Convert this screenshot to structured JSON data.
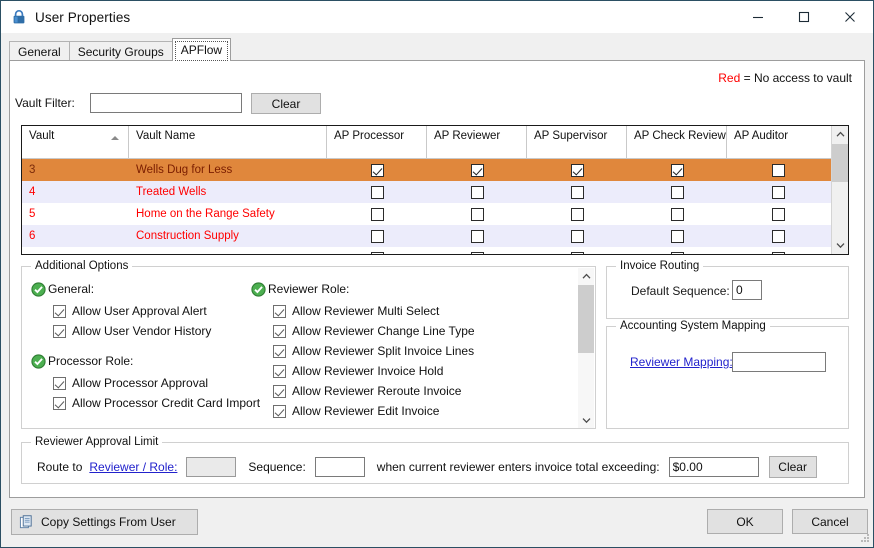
{
  "window": {
    "title": "User Properties",
    "icon": "lock-icon",
    "minimize": "minimize-icon",
    "maximize": "maximize-icon",
    "close": "close-icon"
  },
  "tabs": [
    {
      "label": "General",
      "active": false
    },
    {
      "label": "Security Groups",
      "active": false
    },
    {
      "label": "APFlow",
      "active": true
    }
  ],
  "legend": {
    "keyword": "Red",
    "description": "= No access to vault",
    "keyword_color": "#ff0000"
  },
  "filter": {
    "label": "Vault Filter:",
    "value": "",
    "placeholder": "",
    "clear_label": "Clear"
  },
  "grid": {
    "columns": [
      "Vault",
      "Vault Name",
      "AP Processor",
      "AP Reviewer",
      "AP Supervisor",
      "AP Check Review",
      "AP Auditor"
    ],
    "sort_column": "Vault",
    "sort_direction": "asc",
    "selection_color": "#e0873c",
    "no_access_text_color": "#ff0000",
    "rows": [
      {
        "vault": "3",
        "name": "Wells Dug for Less",
        "selected": true,
        "no_access": false,
        "checks": [
          true,
          true,
          true,
          true,
          false
        ]
      },
      {
        "vault": "4",
        "name": "Treated Wells",
        "selected": false,
        "no_access": true,
        "checks": [
          false,
          false,
          false,
          false,
          false
        ]
      },
      {
        "vault": "5",
        "name": "Home on the Range Safety",
        "selected": false,
        "no_access": true,
        "checks": [
          false,
          false,
          false,
          false,
          false
        ]
      },
      {
        "vault": "6",
        "name": "Construction Supply",
        "selected": false,
        "no_access": true,
        "checks": [
          false,
          false,
          false,
          false,
          false
        ]
      },
      {
        "vault": "",
        "name": "",
        "selected": false,
        "no_access": true,
        "checks": [
          false,
          false,
          false,
          false,
          false
        ]
      }
    ]
  },
  "additional_options": {
    "title": "Additional Options",
    "groups": [
      {
        "heading": "General:",
        "icon": "green-check-icon",
        "items": [
          {
            "label": "Allow User Approval Alert",
            "checked": true
          },
          {
            "label": "Allow User Vendor History",
            "checked": true
          }
        ]
      },
      {
        "heading": "Processor Role:",
        "icon": "green-check-icon",
        "items": [
          {
            "label": "Allow Processor Approval",
            "checked": true
          },
          {
            "label": "Allow Processor Credit Card Import",
            "checked": true
          }
        ]
      },
      {
        "heading": "Reviewer Role:",
        "icon": "green-check-icon",
        "items": [
          {
            "label": "Allow Reviewer Multi Select",
            "checked": true
          },
          {
            "label": "Allow Reviewer Change Line Type",
            "checked": true
          },
          {
            "label": "Allow Reviewer Split Invoice Lines",
            "checked": true
          },
          {
            "label": "Allow Reviewer Invoice Hold",
            "checked": true
          },
          {
            "label": "Allow Reviewer Reroute Invoice",
            "checked": true
          },
          {
            "label": "Allow Reviewer Edit Invoice",
            "checked": true
          }
        ]
      }
    ]
  },
  "invoice_routing": {
    "title": "Invoice Routing",
    "default_sequence_label": "Default Sequence:",
    "default_sequence_value": "0"
  },
  "accounting_mapping": {
    "title": "Accounting System Mapping",
    "reviewer_mapping_label": "Reviewer Mapping:",
    "reviewer_mapping_value": "",
    "link_color": "#2222cc"
  },
  "approval_limit": {
    "title": "Reviewer Approval Limit",
    "route_to_label": "Route to",
    "reviewer_role_link": "Reviewer / Role:",
    "reviewer_role_value": "",
    "sequence_label": "Sequence:",
    "sequence_value": "",
    "condition_text": "when current reviewer enters invoice total exceeding:",
    "amount_value": "$0.00",
    "clear_label": "Clear"
  },
  "footer": {
    "copy_settings_label": "Copy Settings From User",
    "copy_icon": "copy-document-icon",
    "ok_label": "OK",
    "cancel_label": "Cancel"
  }
}
